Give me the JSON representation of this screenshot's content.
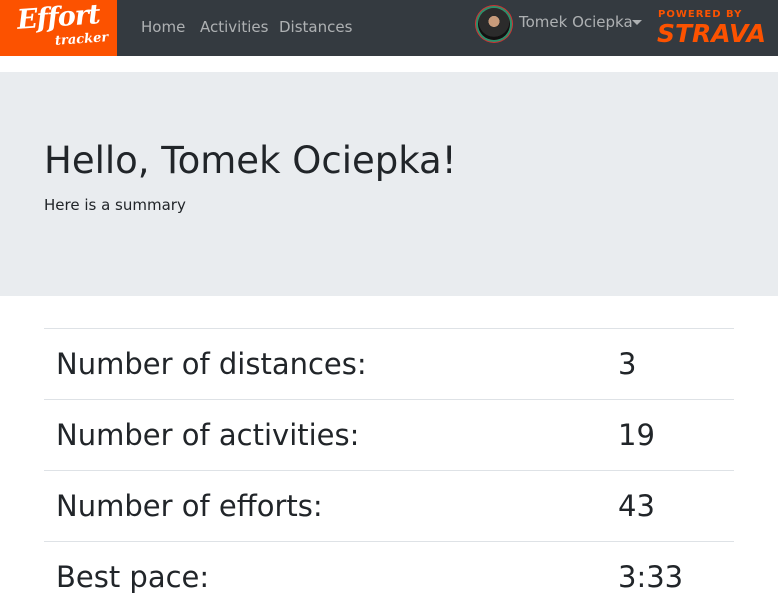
{
  "nav": {
    "brand_top": "Effort",
    "brand_bottom": "tracker",
    "links": [
      {
        "label": "Home"
      },
      {
        "label": "Activities"
      },
      {
        "label": "Distances"
      }
    ],
    "user_name": "Tomek Ociepka",
    "powered_by": "POWERED BY",
    "strava": "STRAVA",
    "colors": {
      "navbar": "#343a40",
      "brand": "#fc5200"
    }
  },
  "hero": {
    "greeting": "Hello, Tomek Ociepka!",
    "subtitle": "Here is a summary"
  },
  "stats": [
    {
      "label": "Number of distances:",
      "value": "3"
    },
    {
      "label": "Number of activities:",
      "value": "19"
    },
    {
      "label": "Number of efforts:",
      "value": "43"
    },
    {
      "label": "Best pace:",
      "value": "3:33"
    }
  ]
}
